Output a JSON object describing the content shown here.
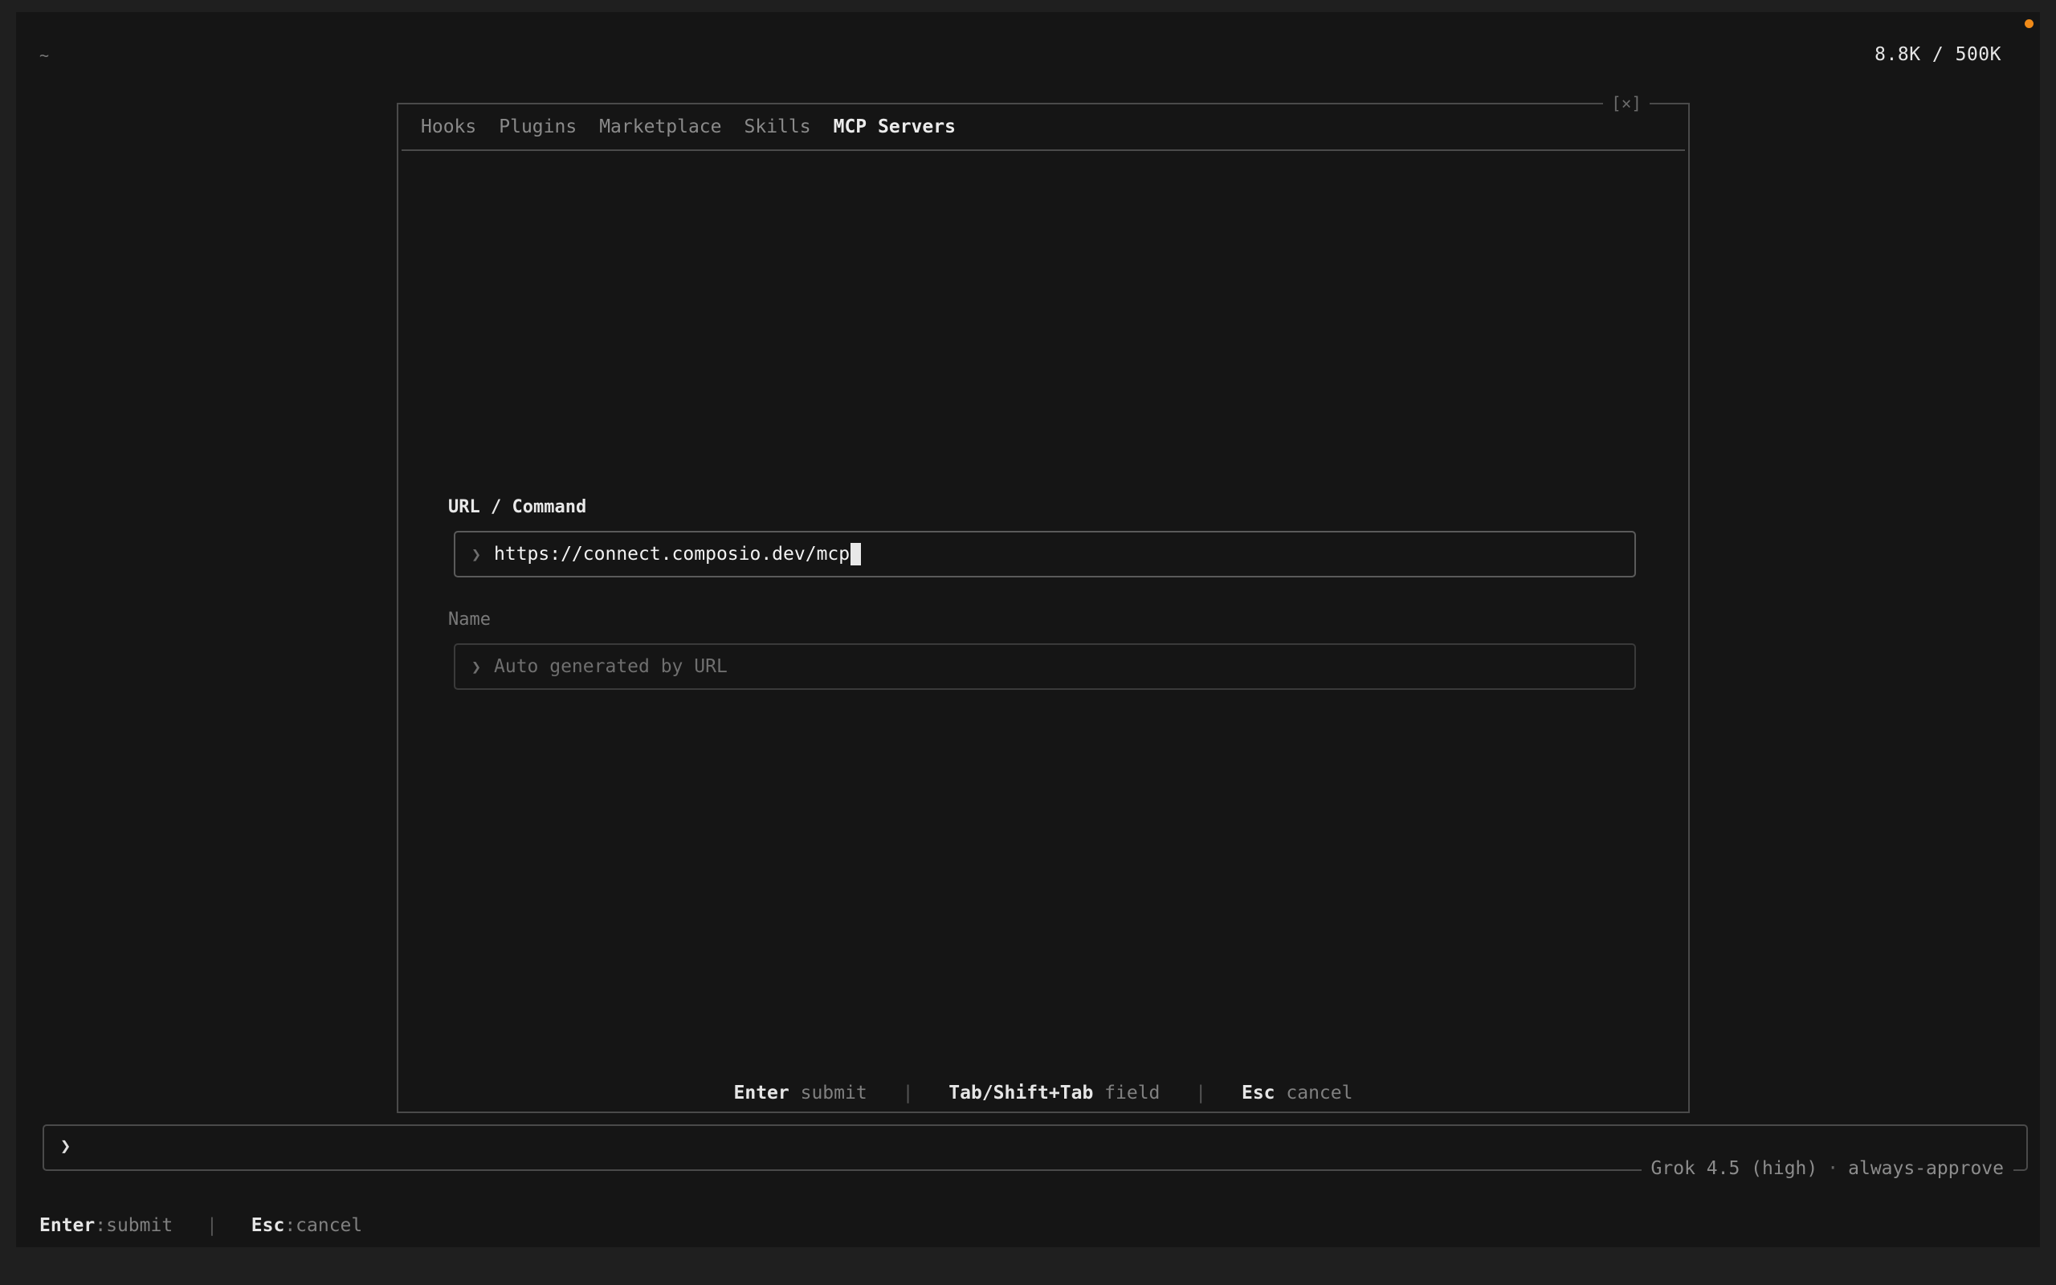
{
  "header": {
    "cwd": "~",
    "tokens": "8.8K / 500K"
  },
  "dialog": {
    "close_label": "[×]",
    "tabs": [
      {
        "label": "Hooks"
      },
      {
        "label": "Plugins"
      },
      {
        "label": "Marketplace"
      },
      {
        "label": "Skills"
      },
      {
        "label": "MCP Servers",
        "active": true
      }
    ],
    "url_field": {
      "label": "URL / Command",
      "value": "https://connect.composio.dev/mcp"
    },
    "name_field": {
      "label": "Name",
      "placeholder": "Auto generated by URL"
    },
    "input_chevron": "❯",
    "footer": {
      "submit_key": "Enter",
      "submit_label": "submit",
      "field_key": "Tab/Shift+Tab",
      "field_label": "field",
      "cancel_key": "Esc",
      "cancel_label": "cancel",
      "separator": "|"
    }
  },
  "prompt": {
    "chevron": "❯",
    "model": "Grok 4.5 (high)",
    "dot": "·",
    "mode": "always-approve"
  },
  "bottom_hints": {
    "submit_key": "Enter",
    "submit_label": ":submit",
    "cancel_key": "Esc",
    "cancel_label": ":cancel",
    "separator": "|"
  },
  "colors": {
    "background": "#151515",
    "outer": "#1f1f1f",
    "status_dot": "#f08a18"
  }
}
